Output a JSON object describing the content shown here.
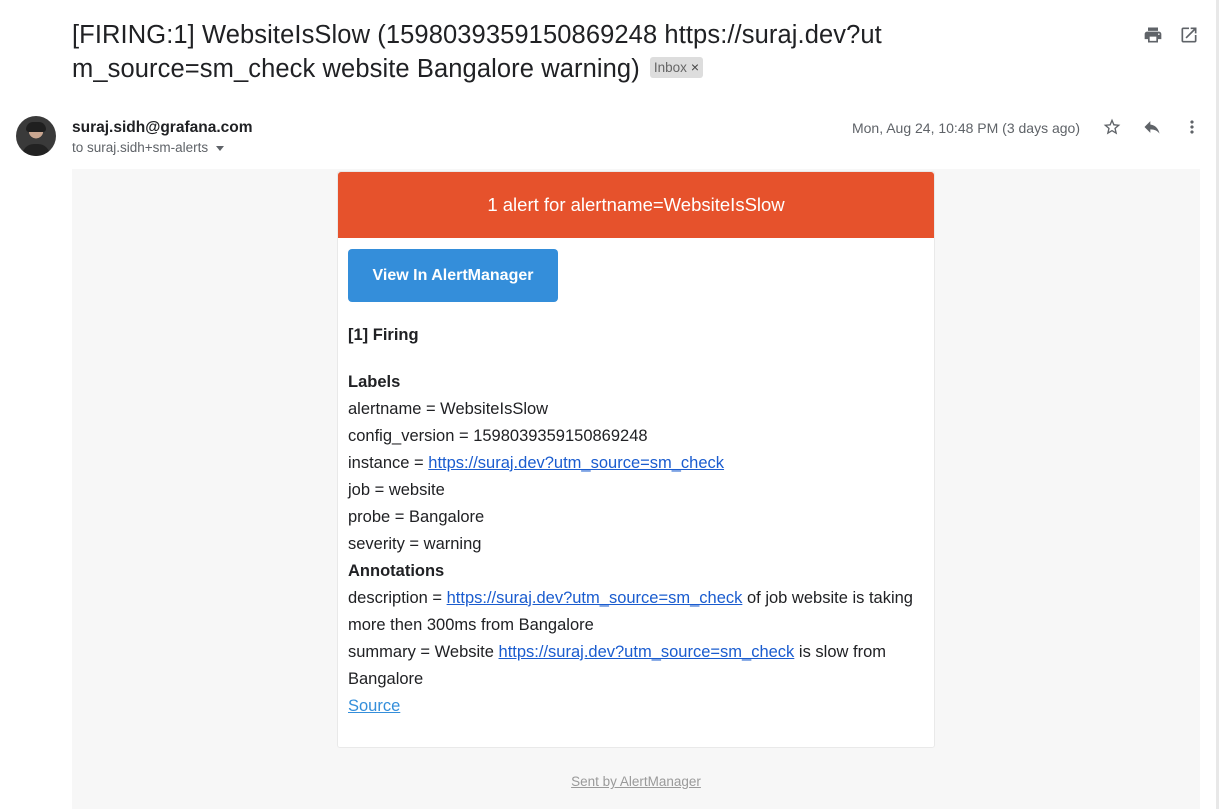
{
  "email": {
    "subject": "[FIRING:1] WebsiteIsSlow (1598039359150869248 https://suraj.dev?utm_source=sm_check website Bangalore warning)",
    "label_chip": "Inbox",
    "sender": "suraj.sidh@grafana.com",
    "recipient": "to suraj.sidh+sm-alerts",
    "date": "Mon, Aug 24, 10:48 PM (3 days ago)"
  },
  "icons": {
    "print": "print-icon",
    "open_new_window": "open-in-new-window-icon",
    "star": "star-icon",
    "reply": "reply-icon",
    "more": "more-vert-icon",
    "chip_close": "close-icon"
  },
  "alert": {
    "header": "1 alert for alertname=WebsiteIsSlow",
    "button": "View In AlertManager",
    "firing_title": "[1] Firing",
    "labels_title": "Labels",
    "labels": {
      "alertname": "alertname = WebsiteIsSlow",
      "config_version": "config_version = 1598039359150869248",
      "instance_prefix": "instance = ",
      "instance_link": "https://suraj.dev?utm_source=sm_check",
      "job": "job = website",
      "probe": "probe = Bangalore",
      "severity": "severity = warning"
    },
    "annotations_title": "Annotations",
    "annotations": {
      "description_prefix": "description = ",
      "description_link": "https://suraj.dev?utm_source=sm_check",
      "description_suffix": " of job website is taking more then 300ms from Bangalore",
      "summary_prefix": "summary = Website ",
      "summary_link": "https://suraj.dev?utm_source=sm_check",
      "summary_suffix": " is slow from Bangalore"
    },
    "source_link": "Source"
  },
  "footer": {
    "sent_by": "Sent by AlertManager"
  },
  "colors": {
    "alert_header_bg": "#e6522c",
    "button_bg": "#348eda",
    "link": "#1a5ccf"
  }
}
